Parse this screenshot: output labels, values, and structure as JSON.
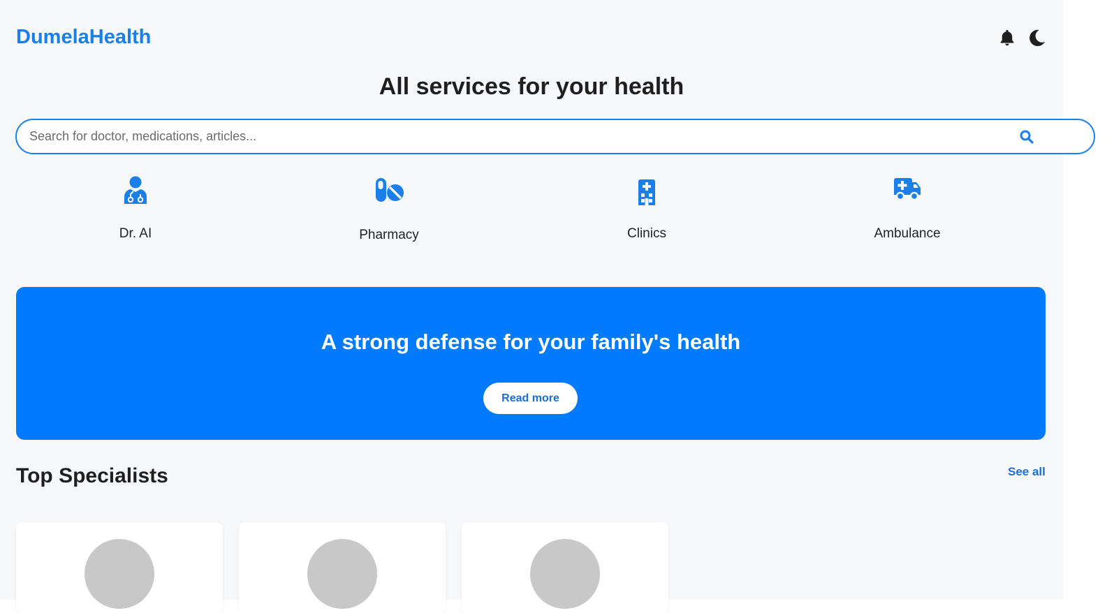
{
  "header": {
    "logo": "DumelaHealth",
    "icons": [
      "bell-icon",
      "moon-icon"
    ]
  },
  "headline": "All services for your health",
  "search": {
    "placeholder": "Search for doctor, medications, articles...",
    "value": "",
    "icon": "search-icon"
  },
  "services": [
    {
      "label": "Dr. AI",
      "icon": "doctor-icon"
    },
    {
      "label": "Pharmacy",
      "icon": "pills-icon"
    },
    {
      "label": "Clinics",
      "icon": "hospital-icon"
    },
    {
      "label": "Ambulance",
      "icon": "ambulance-icon"
    }
  ],
  "banner": {
    "title": "A strong defense for your family's health",
    "button_label": "Read more"
  },
  "specialists": {
    "title": "Top Specialists",
    "see_all_label": "See all",
    "cards": [
      {
        "avatar": "placeholder"
      },
      {
        "avatar": "placeholder"
      },
      {
        "avatar": "placeholder"
      }
    ]
  },
  "colors": {
    "accent": "#1a7fe8",
    "banner": "#007bff",
    "background": "#f7f8fa",
    "avatar_placeholder": "#c8c8c8"
  }
}
